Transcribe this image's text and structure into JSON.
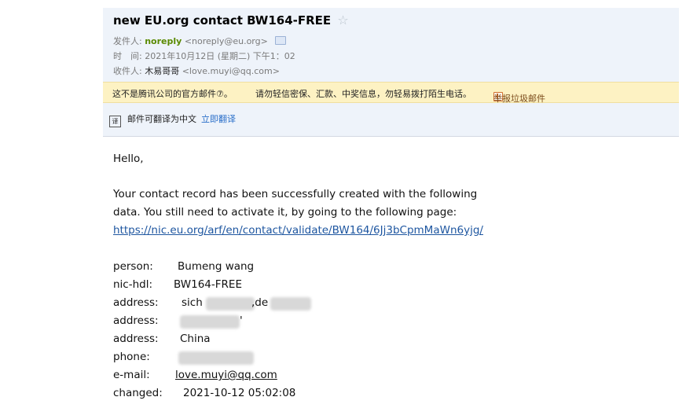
{
  "email": {
    "subject": "new EU.org contact BW164-FREE",
    "star_icon": "☆",
    "from_label": "发件人:",
    "from_name": "noreply",
    "from_addr": "<noreply@eu.org>",
    "time_label": "时　间:",
    "time_value": "2021年10月12日 (星期二) 下午1：02",
    "to_label": "收件人:",
    "to_name": "木易哥哥",
    "to_addr": "<love.muyi@qq.com>"
  },
  "warning": {
    "text1": "这不是腾讯公司的官方邮件⑦。",
    "text2": "请勿轻信密保、汇款、中奖信息，勿轻易拨打陌生电话。",
    "report": "举报垃圾邮件"
  },
  "translate": {
    "icon_glyph": "译",
    "text": "邮件可翻译为中文",
    "link": "立即翻译"
  },
  "body": {
    "greeting": "Hello,",
    "line1": "Your contact record has been successfully created with the following",
    "line2": "data. You still need to activate it, by going to the following page:",
    "url": "https://nic.eu.org/arf/en/contact/validate/BW164/6Jj3bCpmMaWn6yjg/"
  },
  "record": {
    "person_label": "person:",
    "person_value": "Bumeng wang",
    "nic_label": "nic-hdl:",
    "nic_value": "BW164-FREE",
    "address1_label": "address:",
    "address1_part1": "sich",
    "address1_part2": ",de",
    "address2_label": "address:",
    "address2_tail": "'",
    "address3_label": "address:",
    "address3_value": "China",
    "phone_label": "phone:",
    "email_label": "e-mail:",
    "email_value": "love.muyi@qq.com",
    "changed_label": "changed:",
    "changed_value": "2021-10-12 05:02:08"
  }
}
